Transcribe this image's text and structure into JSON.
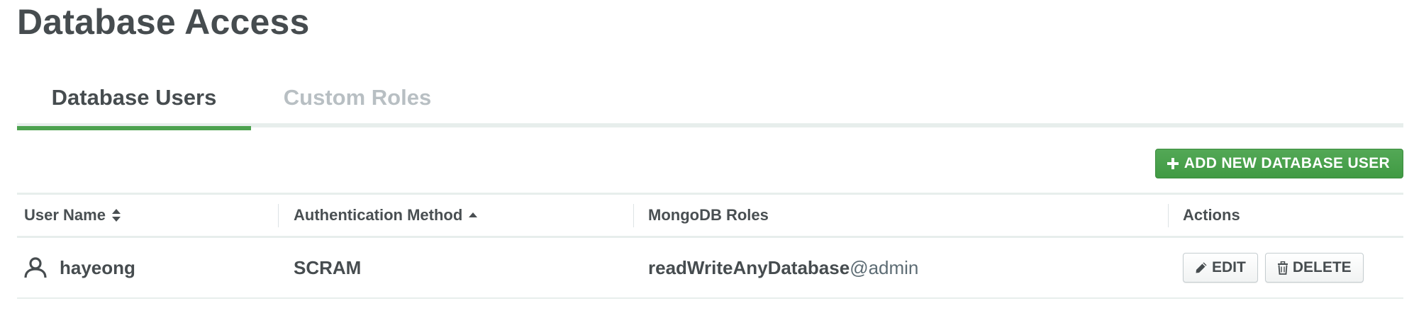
{
  "page": {
    "title": "Database Access"
  },
  "tabs": [
    {
      "label": "Database Users",
      "active": true
    },
    {
      "label": "Custom Roles",
      "active": false
    }
  ],
  "toolbar": {
    "add_user_label": "ADD NEW DATABASE USER",
    "add_user_icon": "plus-icon"
  },
  "table": {
    "columns": [
      {
        "label": "User Name",
        "sort_icon": "sort-both-icon"
      },
      {
        "label": "Authentication Method",
        "sort_icon": "sort-asc-icon"
      },
      {
        "label": "MongoDB Roles"
      },
      {
        "label": "Actions"
      }
    ],
    "rows": [
      {
        "user_icon": "user-icon",
        "username": "hayeong",
        "auth_method": "SCRAM",
        "role_name": "readWriteAnyDatabase",
        "role_db": "@admin",
        "edit_label": "EDIT",
        "edit_icon": "pencil-icon",
        "delete_label": "DELETE",
        "delete_icon": "trash-icon"
      }
    ]
  },
  "colors": {
    "accent_green": "#4da24f",
    "tab_border": "#e7eeec",
    "text_dark": "#464c4f",
    "text_inactive": "#b8bfc3"
  }
}
